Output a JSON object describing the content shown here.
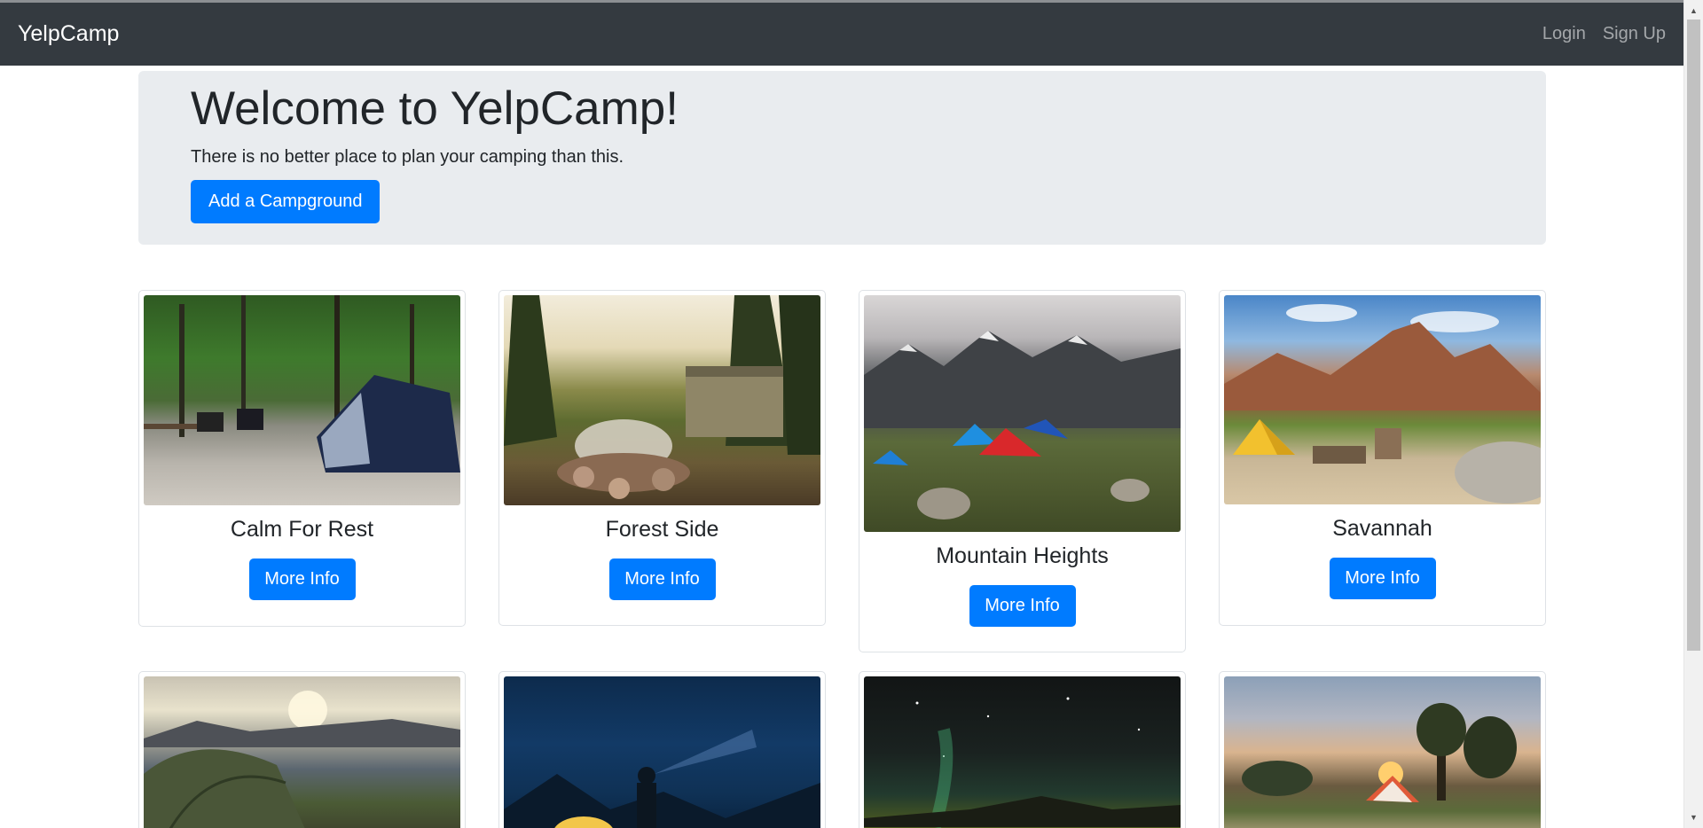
{
  "navbar": {
    "brand": "YelpCamp",
    "login": "Login",
    "signup": "Sign Up"
  },
  "jumbotron": {
    "title": "Welcome to YelpCamp!",
    "subtitle": "There is no better place to plan your camping than this.",
    "button": "Add a Campground"
  },
  "campgrounds": [
    {
      "name": "Calm For Rest",
      "button": "More Info"
    },
    {
      "name": "Forest Side",
      "button": "More Info"
    },
    {
      "name": "Mountain Heights",
      "button": "More Info"
    },
    {
      "name": "Savannah",
      "button": "More Info"
    }
  ],
  "colors": {
    "navbar": "#343a40",
    "primary": "#007bff",
    "jumbotron": "#e9ecef"
  },
  "icons": {
    "scroll_up": "scroll-up-arrow-icon",
    "scroll_down": "scroll-down-arrow-icon"
  }
}
